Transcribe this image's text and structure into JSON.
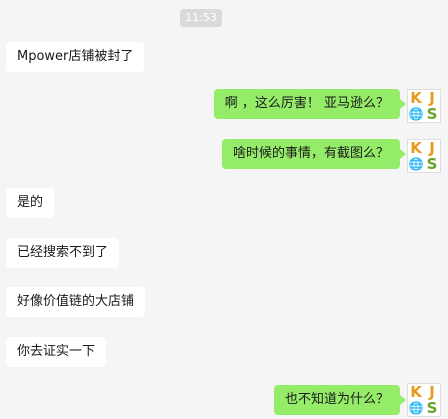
{
  "chat": {
    "timestamp": "11:53",
    "messages": [
      {
        "side": "in",
        "text": "Mpower店铺被封了"
      },
      {
        "side": "out",
        "text": "啊 ，这么厉害！ 亚马逊么？"
      },
      {
        "side": "out",
        "text": "啥时候的事情，有截图么？"
      },
      {
        "side": "in",
        "text": "是的"
      },
      {
        "side": "in",
        "text": "已经搜索不到了"
      },
      {
        "side": "in",
        "text": "好像价值链的大店铺"
      },
      {
        "side": "in",
        "text": "你去证实一下"
      },
      {
        "side": "out",
        "text": "也不知道为什么？"
      }
    ]
  },
  "avatar": {
    "letters": [
      "K",
      "J",
      "S"
    ],
    "icon": "globe-icon"
  },
  "colors": {
    "background": "#f5f5f5",
    "incoming": "#ffffff",
    "outgoing": "#95ec69",
    "timestamp_bg": "#dadada"
  }
}
